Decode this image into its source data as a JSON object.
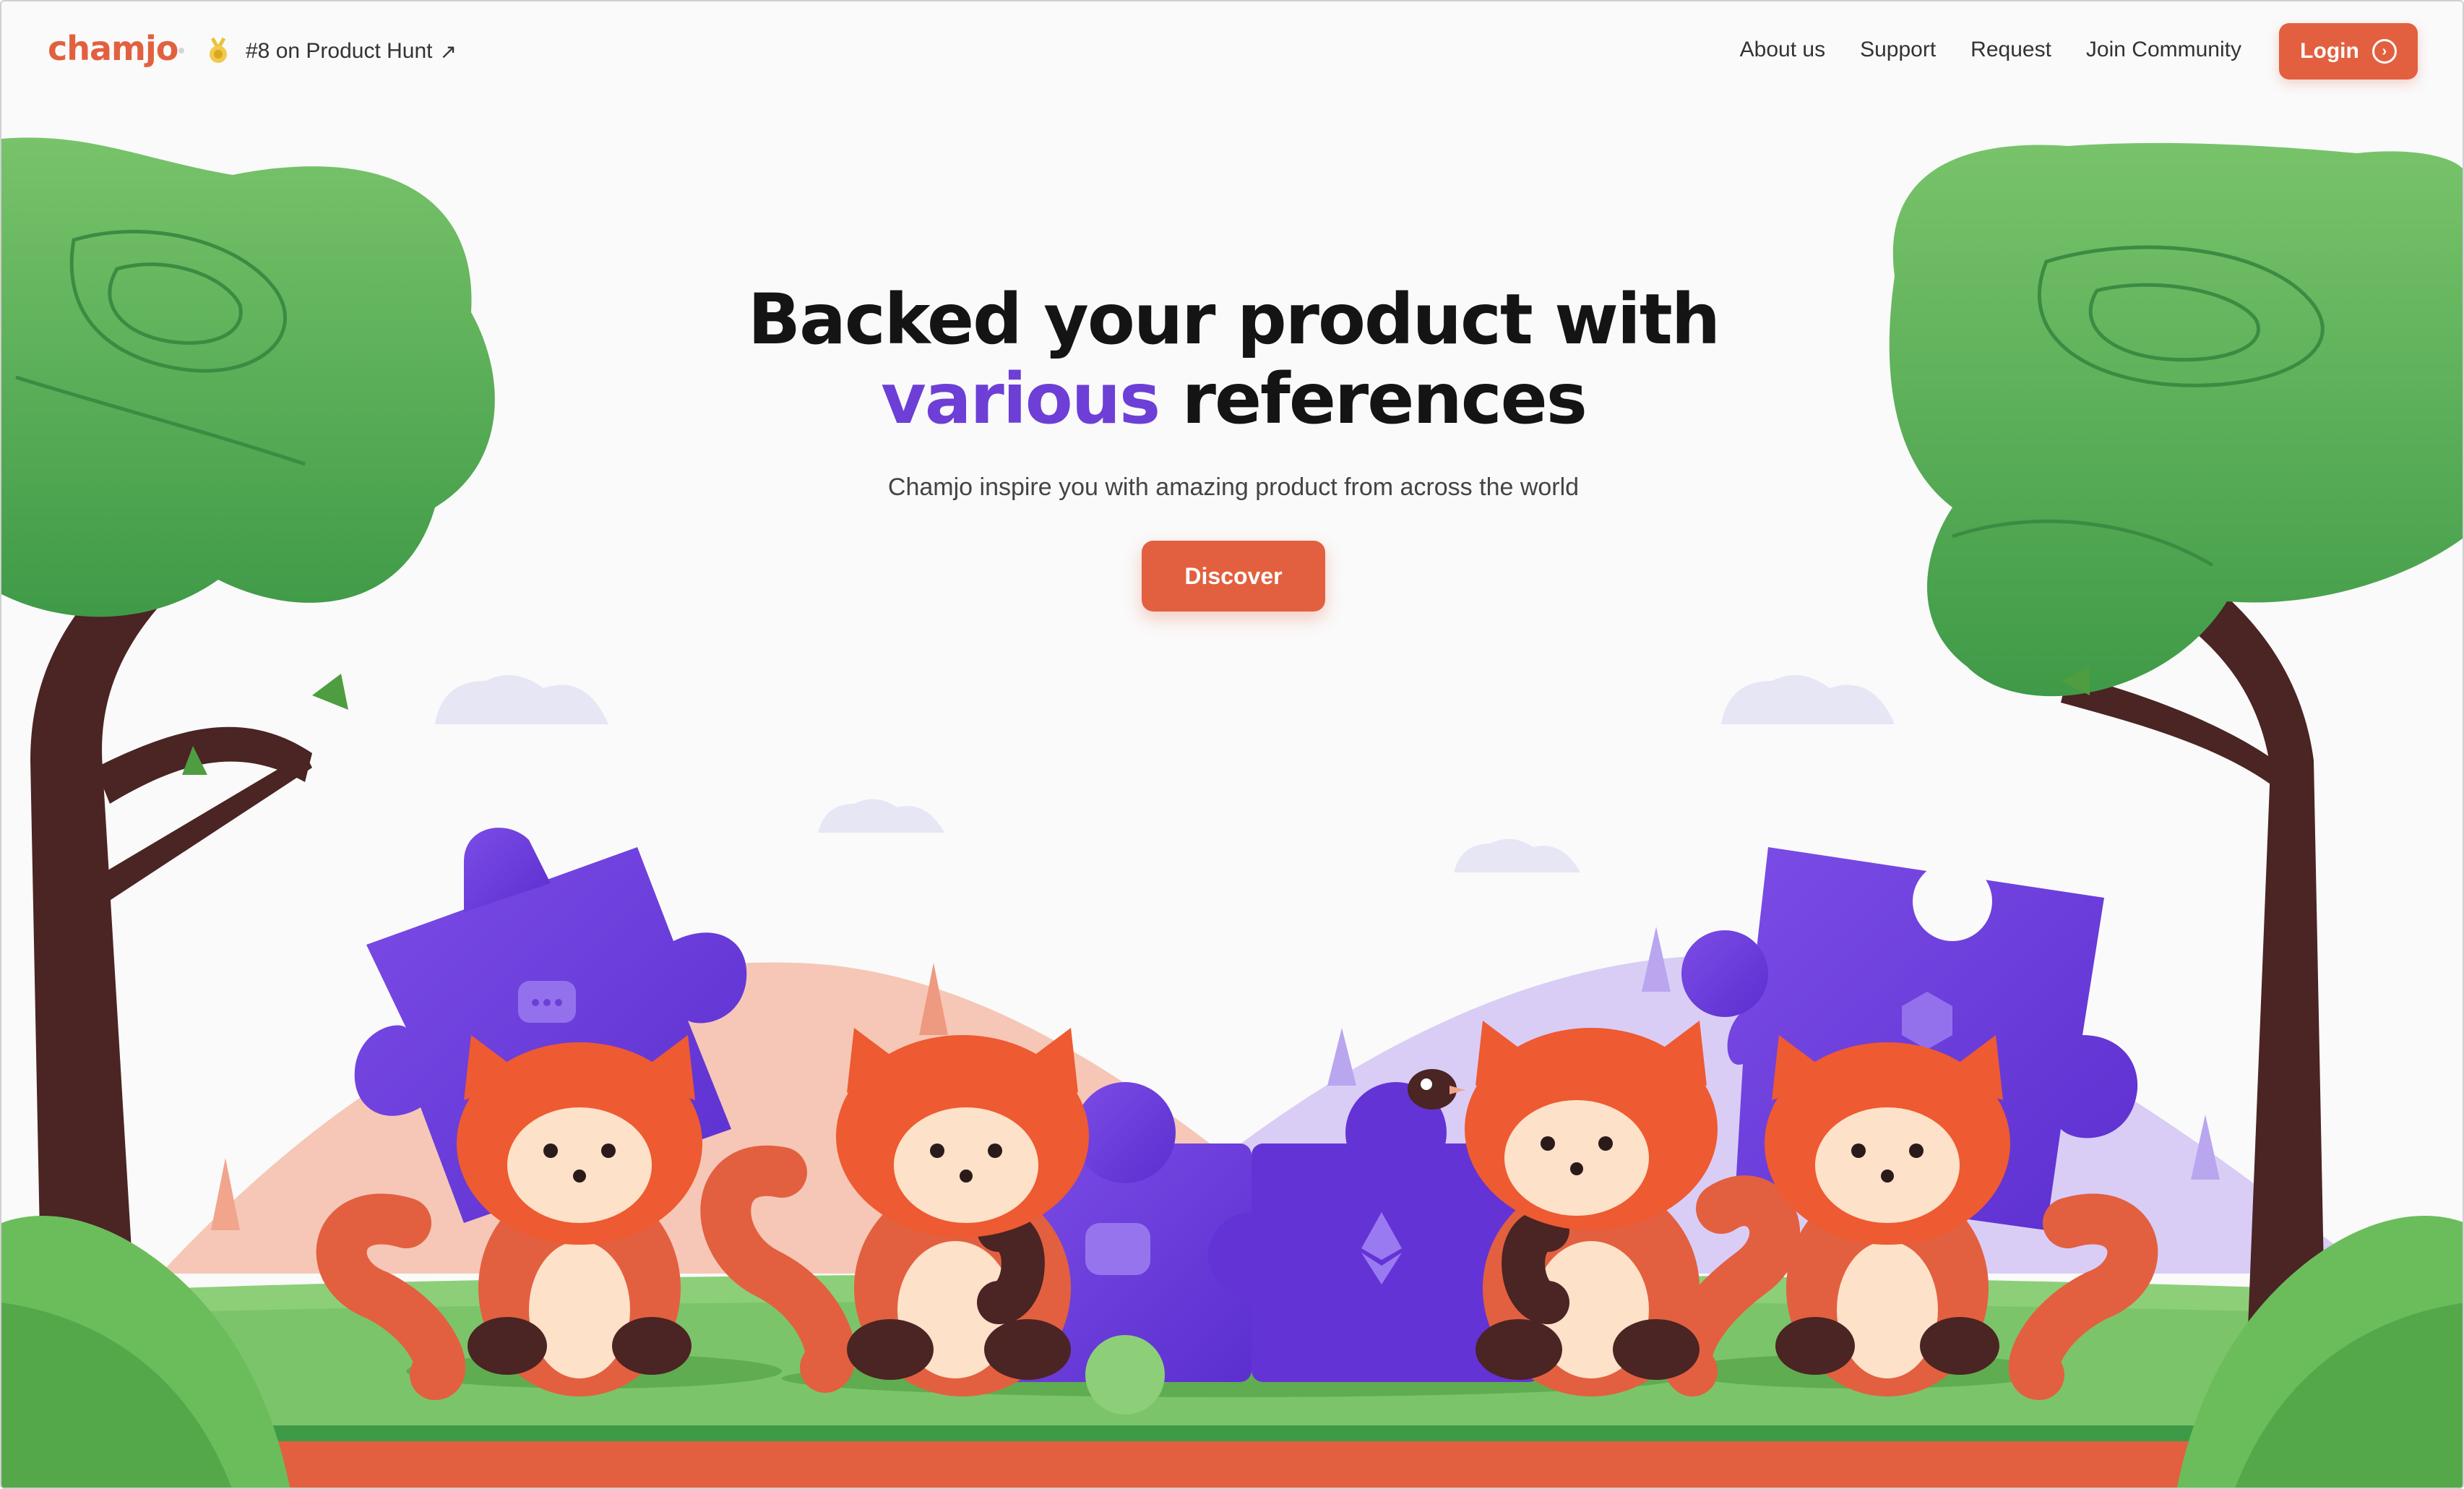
{
  "nav": {
    "logo": "chamjo",
    "product_hunt": {
      "text": "#8 on Product Hunt",
      "arrow": "↗",
      "icon": "medal-icon"
    },
    "links": [
      "About us",
      "Support",
      "Request",
      "Join Community"
    ],
    "login": {
      "label": "Login",
      "icon": "chevron-right-circle-icon"
    }
  },
  "hero": {
    "headline_line1": "Backed your product with",
    "headline_accent": "various",
    "headline_rest": " references",
    "subtitle": "Chamjo inspire you with amazing product from across the world",
    "cta": "Discover"
  },
  "colors": {
    "brand": "#e2603f",
    "accent": "#6d3fd6",
    "puzzle": "#7040dd",
    "grass": "#5cb85c",
    "background": "#fafafa"
  },
  "illustration": {
    "subject": "red pandas assembling purple puzzle pieces between two trees",
    "icons": [
      "chat-bubble-icon",
      "cube-icon",
      "ethereum-icon",
      "layers-icon",
      "bird-icon"
    ]
  }
}
